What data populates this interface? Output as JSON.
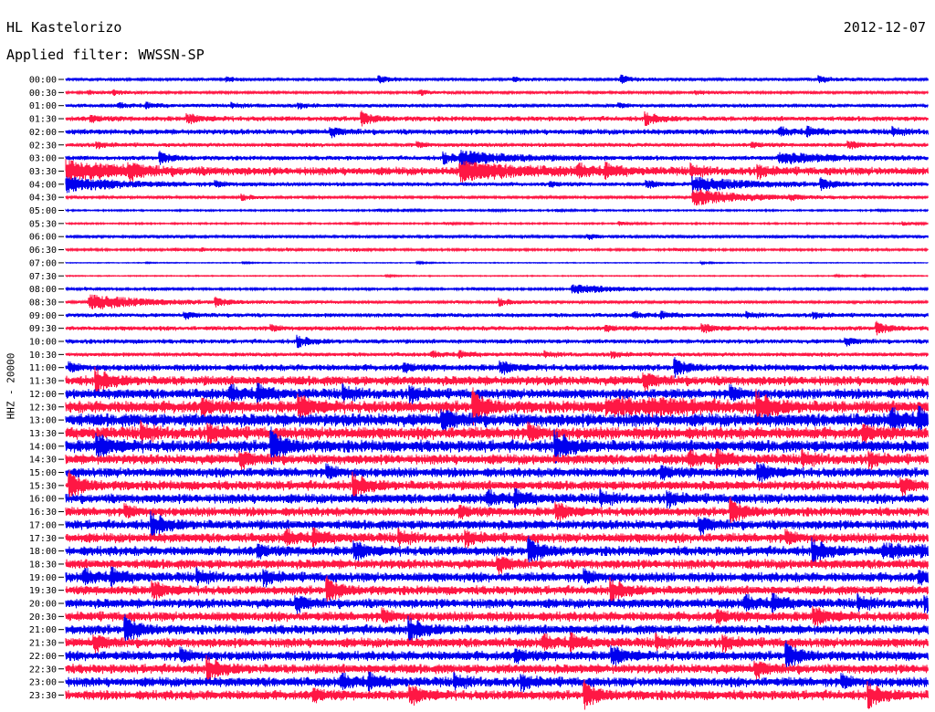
{
  "header": {
    "station": "HL Kastelorizo",
    "date": "2012-12-07",
    "filter": "Applied filter: WWSSN-SP",
    "channel": "HHZ - 20000"
  },
  "colors": {
    "odd_trace": "#0000ee",
    "even_trace": "#ff1744",
    "background": "#ffffff"
  },
  "chart_data": {
    "type": "line",
    "title": "HL Kastelorizo",
    "ylabel": "HHZ - 20000",
    "y_tick_labels": [
      "00:00",
      "00:30",
      "01:00",
      "01:30",
      "02:00",
      "02:30",
      "03:00",
      "03:30",
      "04:00",
      "04:30",
      "05:00",
      "05:30",
      "06:00",
      "06:30",
      "07:00",
      "07:30",
      "08:00",
      "08:30",
      "09:00",
      "09:30",
      "10:00",
      "10:30",
      "11:00",
      "11:30",
      "12:00",
      "12:30",
      "13:00",
      "13:30",
      "14:00",
      "14:30",
      "15:00",
      "15:30",
      "16:00",
      "16:30",
      "17:00",
      "17:30",
      "18:00",
      "18:30",
      "19:00",
      "19:30",
      "20:00",
      "20:30",
      "21:00",
      "21:30",
      "22:00",
      "22:30",
      "23:00",
      "23:30"
    ],
    "trace_colors": [
      "blue",
      "red"
    ],
    "relative_noise_amplitude": [
      0.6,
      0.5,
      0.7,
      1.0,
      1.1,
      0.8,
      0.9,
      1.6,
      0.8,
      0.5,
      0.3,
      0.3,
      0.6,
      0.4,
      0.15,
      0.2,
      0.4,
      0.6,
      0.8,
      0.9,
      0.9,
      0.8,
      1.3,
      1.9,
      2.0,
      2.4,
      2.6,
      2.4,
      2.4,
      2.0,
      1.9,
      1.9,
      1.9,
      1.8,
      1.9,
      1.9,
      1.9,
      1.9,
      1.9,
      1.8,
      1.9,
      1.9,
      1.9,
      1.9,
      1.9,
      1.9,
      1.9,
      1.9
    ],
    "events": [
      {
        "row": "03:30",
        "position": 0.0,
        "amplitude": 3.0
      },
      {
        "row": "04:00",
        "position": 0.0,
        "amplitude": 2.4
      },
      {
        "row": "03:00",
        "position": 0.46,
        "amplitude": 2.0
      },
      {
        "row": "03:30",
        "position": 0.46,
        "amplitude": 2.8
      },
      {
        "row": "04:00",
        "position": 0.73,
        "amplitude": 2.2
      },
      {
        "row": "04:30",
        "position": 0.73,
        "amplitude": 2.6
      },
      {
        "row": "03:00",
        "position": 0.83,
        "amplitude": 1.6
      },
      {
        "row": "08:30",
        "position": 0.03,
        "amplitude": 2.4
      },
      {
        "row": "08:00",
        "position": 0.59,
        "amplitude": 1.4
      },
      {
        "row": "12:30",
        "position": 0.63,
        "amplitude": 2.0
      },
      {
        "row": "12:30",
        "position": 0.68,
        "amplitude": 2.0
      },
      {
        "row": "18:00",
        "position": 0.95,
        "amplitude": 1.6
      }
    ]
  }
}
